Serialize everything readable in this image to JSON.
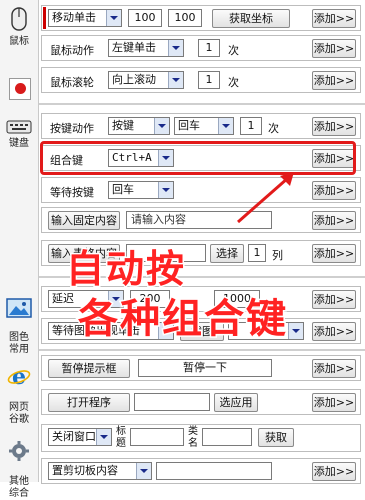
{
  "sidebar": {
    "mouse": "鼠标",
    "keyboard": "键盘",
    "image": "图色\n常用",
    "web": "网页\n谷歌",
    "other": "其他\n综合"
  },
  "rows": {
    "move": {
      "action": "移动单击",
      "x": "100",
      "y": "100",
      "get": "获取坐标",
      "add": "添加>>"
    },
    "mouse_action": {
      "label": "鼠标动作",
      "value": "左键单击",
      "count": "1",
      "unit": "次",
      "add": "添加>>"
    },
    "wheel": {
      "label": "鼠标滚轮",
      "value": "向上滚动",
      "count": "1",
      "unit": "次",
      "add": "添加>>"
    },
    "key_action": {
      "label": "按键动作",
      "mode": "按键",
      "key": "回车",
      "count": "1",
      "unit": "次",
      "add": "添加>>"
    },
    "combo": {
      "label": "组合键",
      "value": "Ctrl+A",
      "add": "添加>>"
    },
    "wait_key": {
      "label": "等待按键",
      "value": "回车",
      "add": "添加>>"
    },
    "input_fixed": {
      "label": "输入固定内容",
      "placeholder": "请输入内容",
      "add": "添加>>"
    },
    "input_table": {
      "label": "输入表格内容",
      "choose": "选择",
      "col": "1",
      "unit": "列",
      "add": "添加>>"
    },
    "delay": {
      "label": "延迟",
      "value": "200",
      "value2": "1000",
      "add": "添加>>"
    },
    "wait_image": {
      "label": "等待图像出现单击",
      "shot": "截图",
      "add": "添加>>"
    },
    "pause": {
      "label": "暂停提示框",
      "btn": "暂停一下",
      "add": "添加>>"
    },
    "open": {
      "label": "打开程序",
      "pick": "选应用",
      "add": "添加>>"
    },
    "close": {
      "label": "关闭窗口",
      "title": "标题",
      "cls": "类名",
      "get": "获取",
      "add": "添加>>"
    },
    "clip": {
      "label": "置剪切板内容",
      "add": "添加>>"
    }
  },
  "overlay": {
    "line1": "自动按",
    "line2": "各种组合键"
  }
}
